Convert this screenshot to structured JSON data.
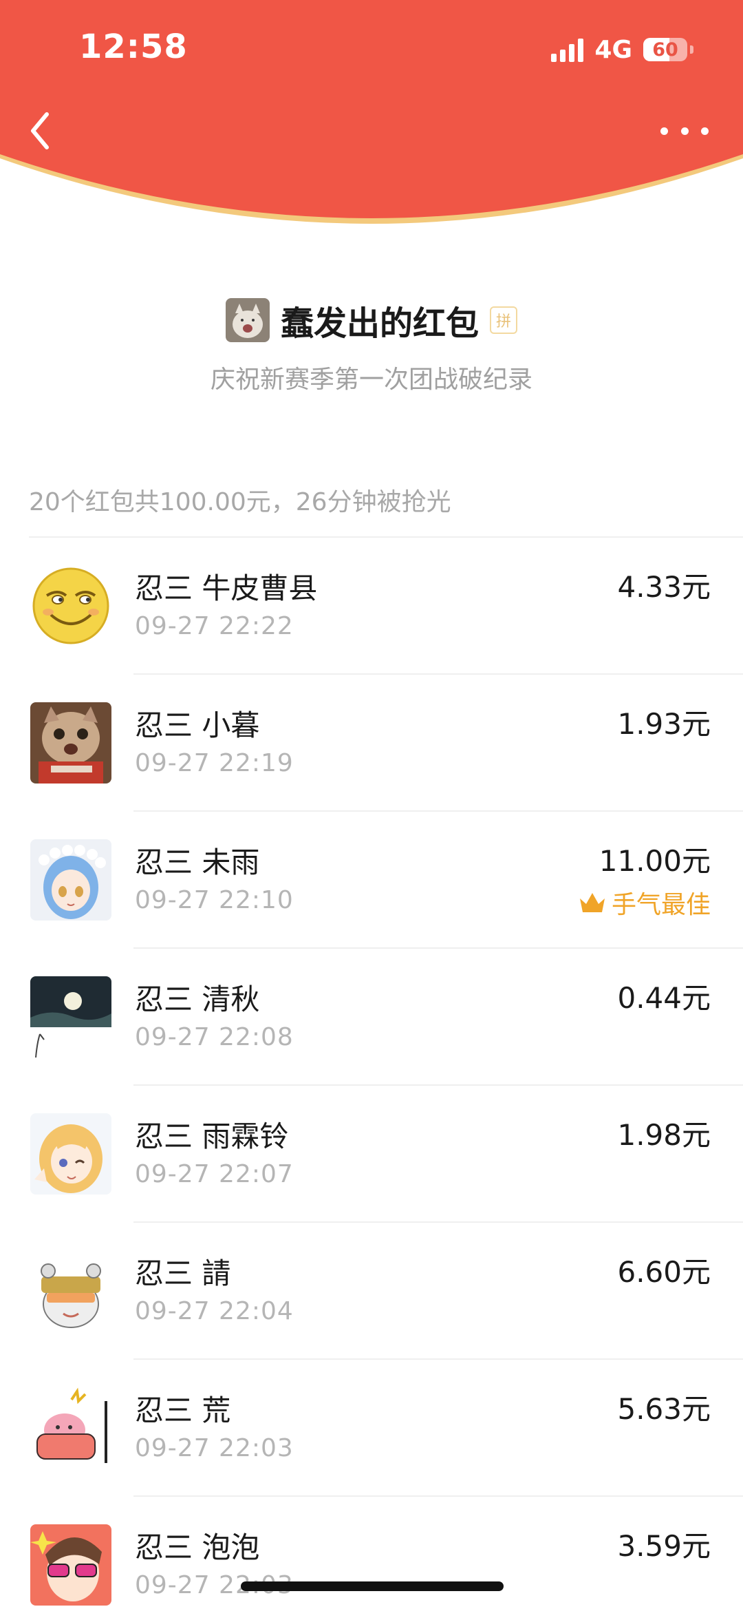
{
  "status_bar": {
    "time": "12:58",
    "network": "4G",
    "battery": "60",
    "battery_level": 0.6
  },
  "nav": {
    "back_icon": "chevron-left-icon",
    "more_icon": "more-dots-icon"
  },
  "colors": {
    "header_red": "#f05646",
    "header_edge": "#f3c97c",
    "best_luck": "#f0a428"
  },
  "envelope": {
    "sender_name": "蠢发出的红包",
    "pin_badge": "拼",
    "blessing": "庆祝新赛季第一次团战破纪录",
    "summary": "20个红包共100.00元，26分钟被抢光"
  },
  "records": [
    {
      "name": "忍三 牛皮曹县",
      "time": "09-27 22:22",
      "amount": "4.33元",
      "best": ""
    },
    {
      "name": "忍三 小暮",
      "time": "09-27 22:19",
      "amount": "1.93元",
      "best": ""
    },
    {
      "name": "忍三 未雨",
      "time": "09-27 22:10",
      "amount": "11.00元",
      "best": "手气最佳"
    },
    {
      "name": "忍三 清秋",
      "time": "09-27 22:08",
      "amount": "0.44元",
      "best": ""
    },
    {
      "name": "忍三 雨霖铃",
      "time": "09-27 22:07",
      "amount": "1.98元",
      "best": ""
    },
    {
      "name": "忍三 請",
      "time": "09-27 22:04",
      "amount": "6.60元",
      "best": ""
    },
    {
      "name": "忍三 荒",
      "time": "09-27 22:03",
      "amount": "5.63元",
      "best": ""
    },
    {
      "name": "忍三 泡泡",
      "time": "09-27 22:03",
      "amount": "3.59元",
      "best": ""
    }
  ]
}
